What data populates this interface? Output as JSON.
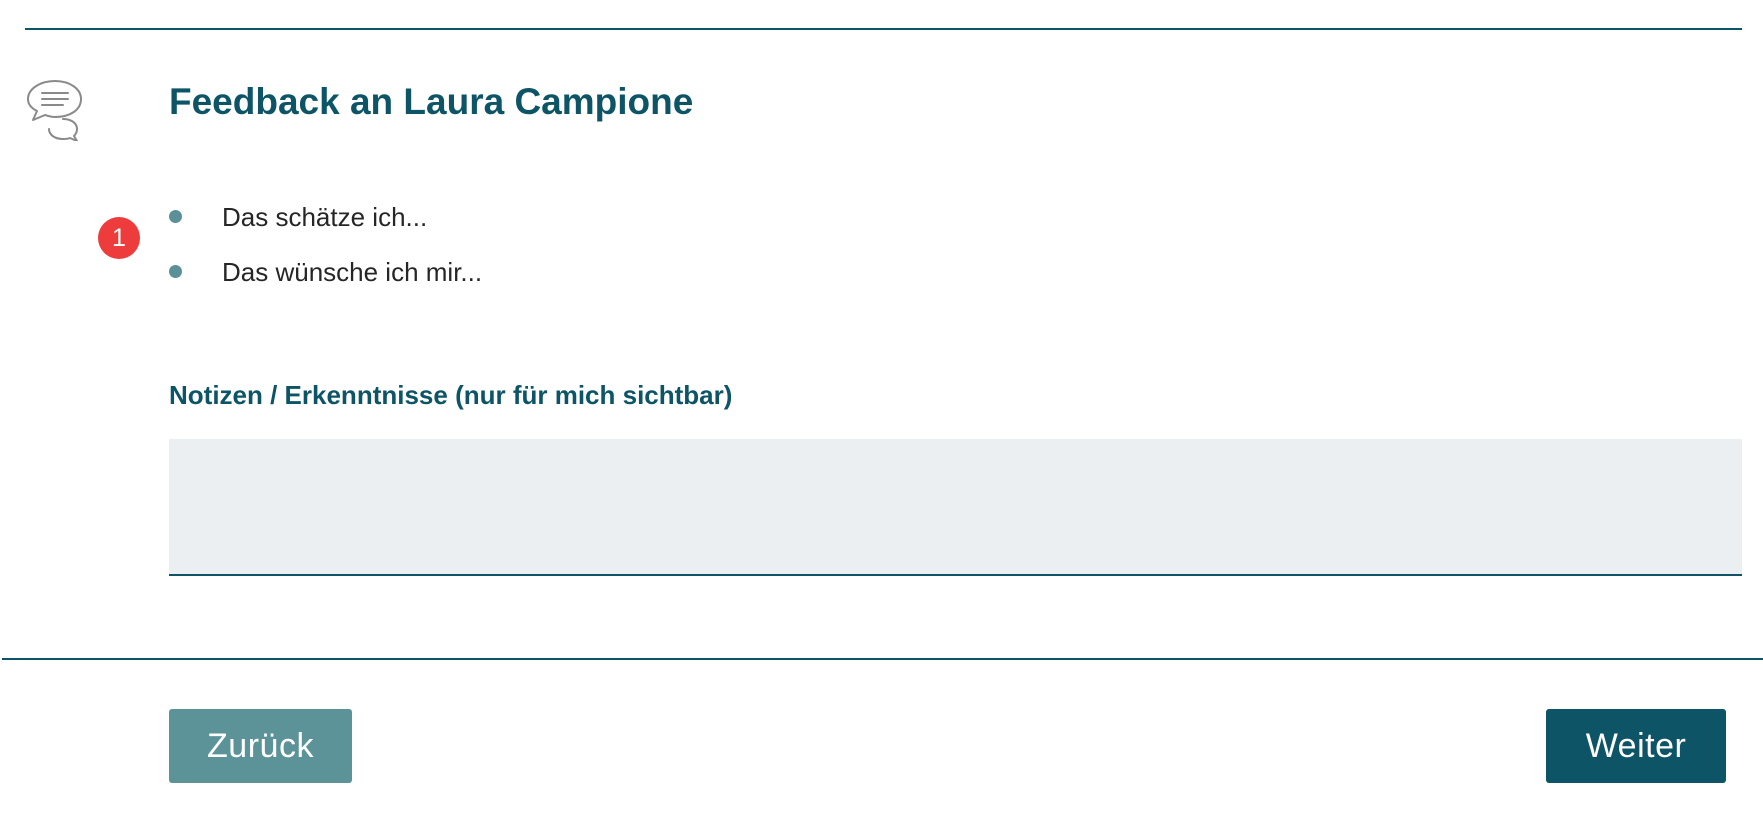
{
  "header": {
    "title": "Feedback an Laura Campione",
    "icon": "chat-bubbles-icon"
  },
  "step_badge": "1",
  "prompts": [
    {
      "label": "Das schätze ich..."
    },
    {
      "label": "Das wünsche ich mir..."
    }
  ],
  "notes": {
    "label": "Notizen / Erkenntnisse (nur für mich sichtbar)",
    "value": ""
  },
  "footer": {
    "back_label": "Zurück",
    "next_label": "Weiter"
  },
  "colors": {
    "primary": "#0d5566",
    "secondary": "#5b9399",
    "badge": "#ee3c3c",
    "field_bg": "#ebeff2"
  }
}
